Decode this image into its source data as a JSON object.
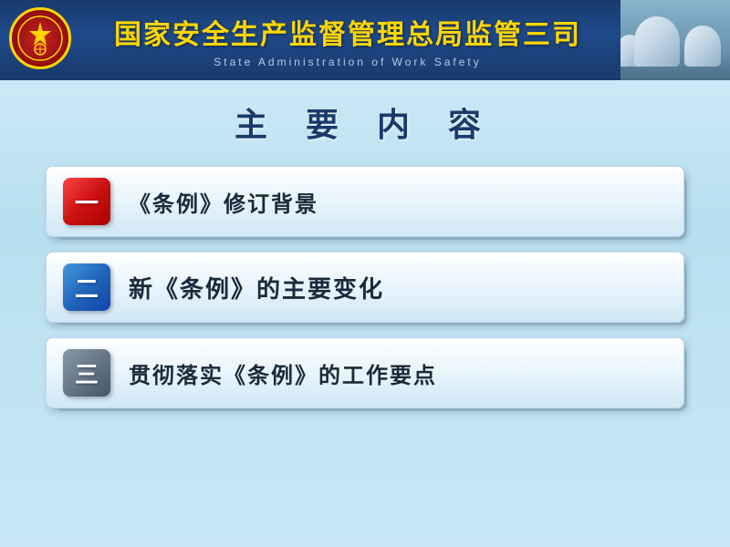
{
  "header": {
    "title_cn": "国家安全生产监督管理总局监管三司",
    "title_en": "State  Administration  of  Work  Safety",
    "logo_text": "☆"
  },
  "page": {
    "main_title": "主 要 内 容",
    "menu_items": [
      {
        "id": 1,
        "badge_label": "一",
        "badge_style": "red",
        "text": "《条例》修订背景"
      },
      {
        "id": 2,
        "badge_label": "二",
        "badge_style": "blue",
        "text": "新《条例》的主要变化"
      },
      {
        "id": 3,
        "badge_label": "三",
        "badge_style": "gray",
        "text": "贯彻落实《条例》的工作要点"
      }
    ]
  }
}
